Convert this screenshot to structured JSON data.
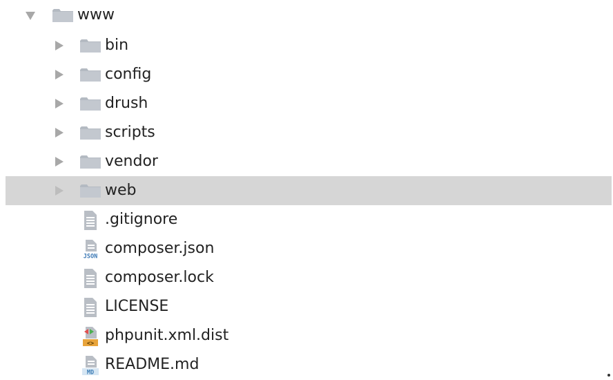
{
  "tree": {
    "root": {
      "label": "www",
      "state": "expanded"
    },
    "folders": [
      {
        "label": "bin",
        "state": "collapsed"
      },
      {
        "label": "config",
        "state": "collapsed"
      },
      {
        "label": "drush",
        "state": "collapsed"
      },
      {
        "label": "scripts",
        "state": "collapsed"
      },
      {
        "label": "vendor",
        "state": "collapsed"
      },
      {
        "label": "web",
        "state": "collapsed",
        "selected": true
      }
    ],
    "files": [
      {
        "label": ".gitignore",
        "icon": "text-file-icon"
      },
      {
        "label": "composer.json",
        "icon": "json-file-icon",
        "badge": "JSON"
      },
      {
        "label": "composer.lock",
        "icon": "text-file-icon"
      },
      {
        "label": "LICENSE",
        "icon": "text-file-icon"
      },
      {
        "label": "phpunit.xml.dist",
        "icon": "xml-file-icon",
        "badge": "<>"
      },
      {
        "label": "README.md",
        "icon": "markdown-file-icon",
        "badge": "MD"
      }
    ]
  },
  "colors": {
    "folder": "#b4bac2",
    "folder_tab": "#c6cbd2",
    "selection": "#d6d6d6",
    "arrow": "#a8a8a8",
    "text": "#222222",
    "json_badge": "#3b78b5",
    "xml_badge": "#e8a43b",
    "md_badge": "#3f7fb7"
  }
}
